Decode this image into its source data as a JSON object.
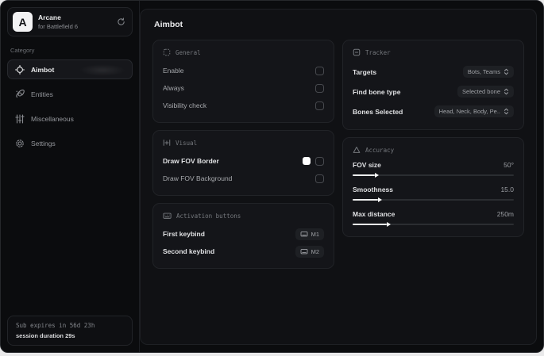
{
  "app": {
    "name": "Arcane",
    "subtitle": "for Battlefield 6",
    "logo_letter": "A"
  },
  "sidebar": {
    "category_label": "Category",
    "items": [
      {
        "label": "Aimbot",
        "icon": "crosshair-icon",
        "active": true
      },
      {
        "label": "Entities",
        "icon": "orbit-icon",
        "active": false
      },
      {
        "label": "Miscellaneous",
        "icon": "sliders-vertical-icon",
        "active": false
      },
      {
        "label": "Settings",
        "icon": "gear-icon",
        "active": false
      }
    ],
    "subscription": {
      "expires_text": "Sub expires in 56d 23h",
      "session_text": "session duration 29s"
    }
  },
  "main": {
    "title": "Aimbot",
    "general": {
      "title": "General",
      "rows": [
        {
          "label": "Enable",
          "checked": false
        },
        {
          "label": "Always",
          "checked": false
        },
        {
          "label": "Visibility check",
          "checked": false
        }
      ]
    },
    "visual": {
      "title": "Visual",
      "rows": [
        {
          "label": "Draw FOV Border",
          "swatch_color": "#ffffff",
          "checked": false
        },
        {
          "label": "Draw FOV Background",
          "checked": false
        }
      ]
    },
    "activation": {
      "title": "Activation buttons",
      "rows": [
        {
          "label": "First keybind",
          "key": "M1"
        },
        {
          "label": "Second keybind",
          "key": "M2"
        }
      ]
    },
    "tracker": {
      "title": "Tracker",
      "rows": [
        {
          "label": "Targets",
          "value": "Bots, Teams"
        },
        {
          "label": "Find bone type",
          "value": "Selected bone"
        },
        {
          "label": "Bones Selected",
          "value": "Head, Neck, Body, Pe.."
        }
      ]
    },
    "accuracy": {
      "title": "Accuracy",
      "sliders": [
        {
          "label": "FOV size",
          "value": "50°",
          "fill_percent": 14
        },
        {
          "label": "Smoothness",
          "value": "15.0",
          "fill_percent": 16
        },
        {
          "label": "Max distance",
          "value": "250m",
          "fill_percent": 21
        }
      ]
    }
  },
  "colors": {
    "window_bg": "#0b0c0e",
    "panel_bg": "#101114",
    "card_bg": "#141519",
    "accent": "#ffffff"
  }
}
